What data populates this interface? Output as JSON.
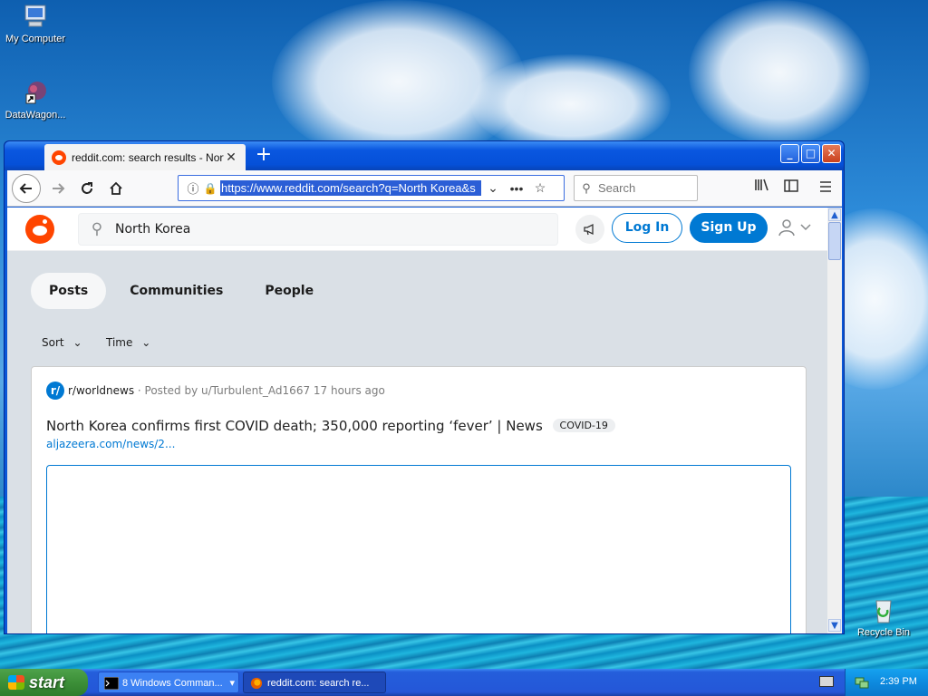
{
  "desktop": {
    "icons": [
      {
        "label": "My Computer",
        "icon": "computer-icon"
      },
      {
        "label": "DataWagon...",
        "icon": "shortcut-icon"
      },
      {
        "label": "Recycle Bin",
        "icon": "recycle-bin-icon"
      }
    ]
  },
  "browser": {
    "tab_title": "reddit.com: search results - North",
    "url": "https://www.reddit.com/search?q=North Korea&s",
    "search_placeholder": "Search"
  },
  "reddit": {
    "search_value": "North Korea",
    "login_label": "Log In",
    "signup_label": "Sign Up",
    "tabs": [
      {
        "label": "Posts",
        "active": true
      },
      {
        "label": "Communities",
        "active": false
      },
      {
        "label": "People",
        "active": false
      }
    ],
    "filters": [
      "Sort",
      "Time"
    ],
    "post": {
      "subreddit": "r/worldnews",
      "meta": "· Posted by u/Turbulent_Ad1667 17 hours ago",
      "title": "North Korea confirms first COVID death; 350,000 reporting ‘fever’ | News",
      "flair": "COVID-19",
      "link": "aljazeera.com/news/2..."
    }
  },
  "taskbar": {
    "start_label": "start",
    "items": [
      {
        "label": "8 Windows Comman..."
      },
      {
        "label": "reddit.com: search re..."
      }
    ],
    "clock": "2:39 PM"
  },
  "colors": {
    "reddit_orange": "#ff4500",
    "reddit_blue": "#0079d3",
    "xp_blue": "#0a56d6",
    "start_green": "#3c8f38"
  }
}
